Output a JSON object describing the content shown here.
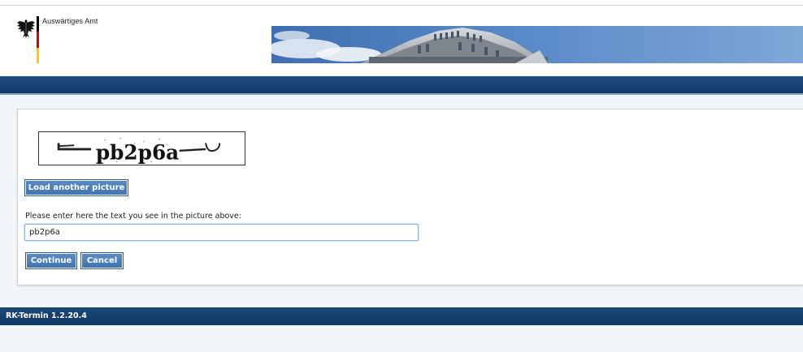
{
  "header": {
    "ministry_name": "Auswärtiges Amt",
    "flag_colors": [
      "#000000",
      "#dd0000",
      "#ffcc00"
    ]
  },
  "captcha": {
    "image_text": "pb2p6a"
  },
  "form": {
    "load_another_label": "Load another picture",
    "prompt": "Please enter here the text you see in the picture above:",
    "answer_value": "pb2p6a",
    "continue_label": "Continue",
    "cancel_label": "Cancel"
  },
  "footer": {
    "version_text": "RK-Termin 1.2.20.4"
  },
  "colors": {
    "header_bar": "#1f4d82",
    "button": "#4a7dbd",
    "footer_bar": "#113763"
  }
}
